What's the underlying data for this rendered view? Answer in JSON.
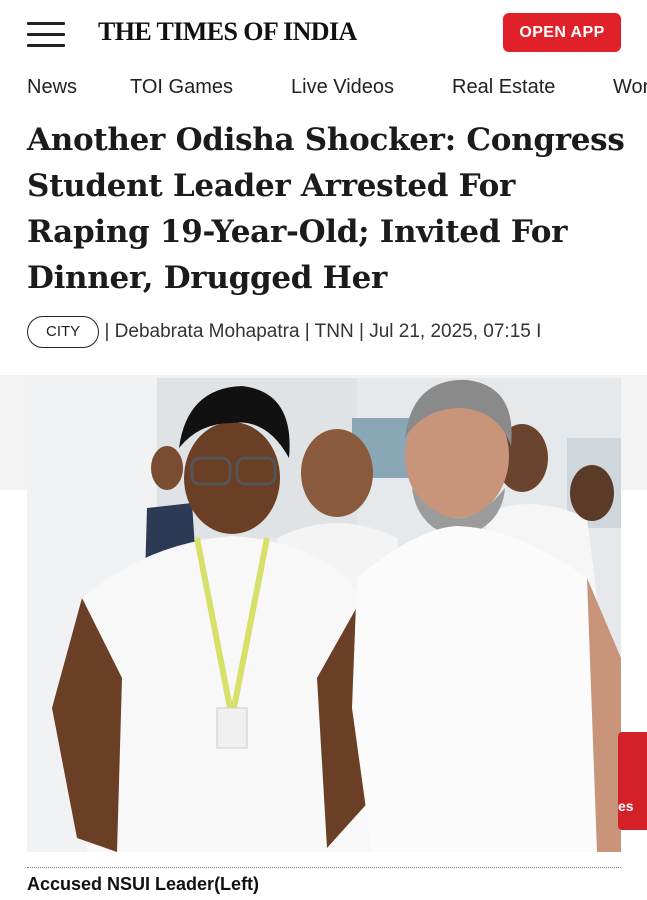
{
  "header": {
    "logo_text": "THE TIMES OF INDIA",
    "open_app_label": "OPEN APP",
    "accent_color": "#e02129"
  },
  "nav": {
    "items": [
      {
        "label": "News"
      },
      {
        "label": "TOI Games"
      },
      {
        "label": "Live Videos"
      },
      {
        "label": "Real Estate"
      },
      {
        "label": "Wor"
      }
    ]
  },
  "article": {
    "headline": "Another Odisha Shocker: Congress Student Leader Arrested For Raping 19-Year-Old; Invited For Dinner, Drugged Her",
    "category": "CITY",
    "byline": "| Debabrata Mohapatra | TNN | Jul 21, 2025, 07:15 I",
    "image_caption": "Accused NSUI Leader(Left)"
  },
  "side_tab": {
    "text": "es"
  }
}
